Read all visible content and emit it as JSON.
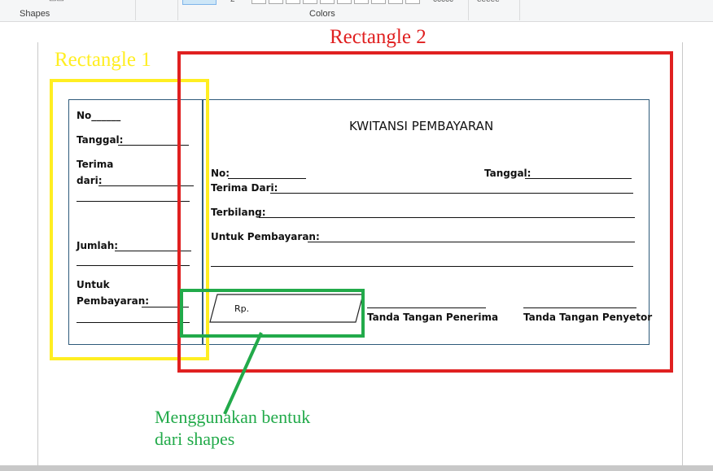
{
  "ribbon": {
    "shapes_label": "Shapes",
    "colors_label": "Colors"
  },
  "annotations": {
    "rect1_label": "Rectangle 1",
    "rect2_label": "Rectangle 2",
    "shapes_note_line1": "Menggunakan bentuk",
    "shapes_note_line2": "dari shapes",
    "colors": {
      "yellow": "#ffee22",
      "red": "#e02020",
      "green": "#22aa4a"
    }
  },
  "receipt": {
    "title": "KWITANSI PEMBAYARAN",
    "stub": {
      "no": "No______",
      "tanggal": "Tanggal:",
      "terima": "Terima",
      "dari": "dari:",
      "jumlah": "Jumlah:",
      "untuk": "Untuk",
      "pembayaran": "Pembayaran:"
    },
    "main": {
      "no": "No:",
      "tanggal": "Tanggal:",
      "terima_dari": "Terima Dari:",
      "terbilang": "Terbilang:",
      "untuk_pembayaran": "Untuk Pembayaran:",
      "rp": "Rp.",
      "ttd_penerima": "Tanda Tangan Penerima",
      "ttd_penyetor": "Tanda Tangan Penyetor"
    }
  }
}
